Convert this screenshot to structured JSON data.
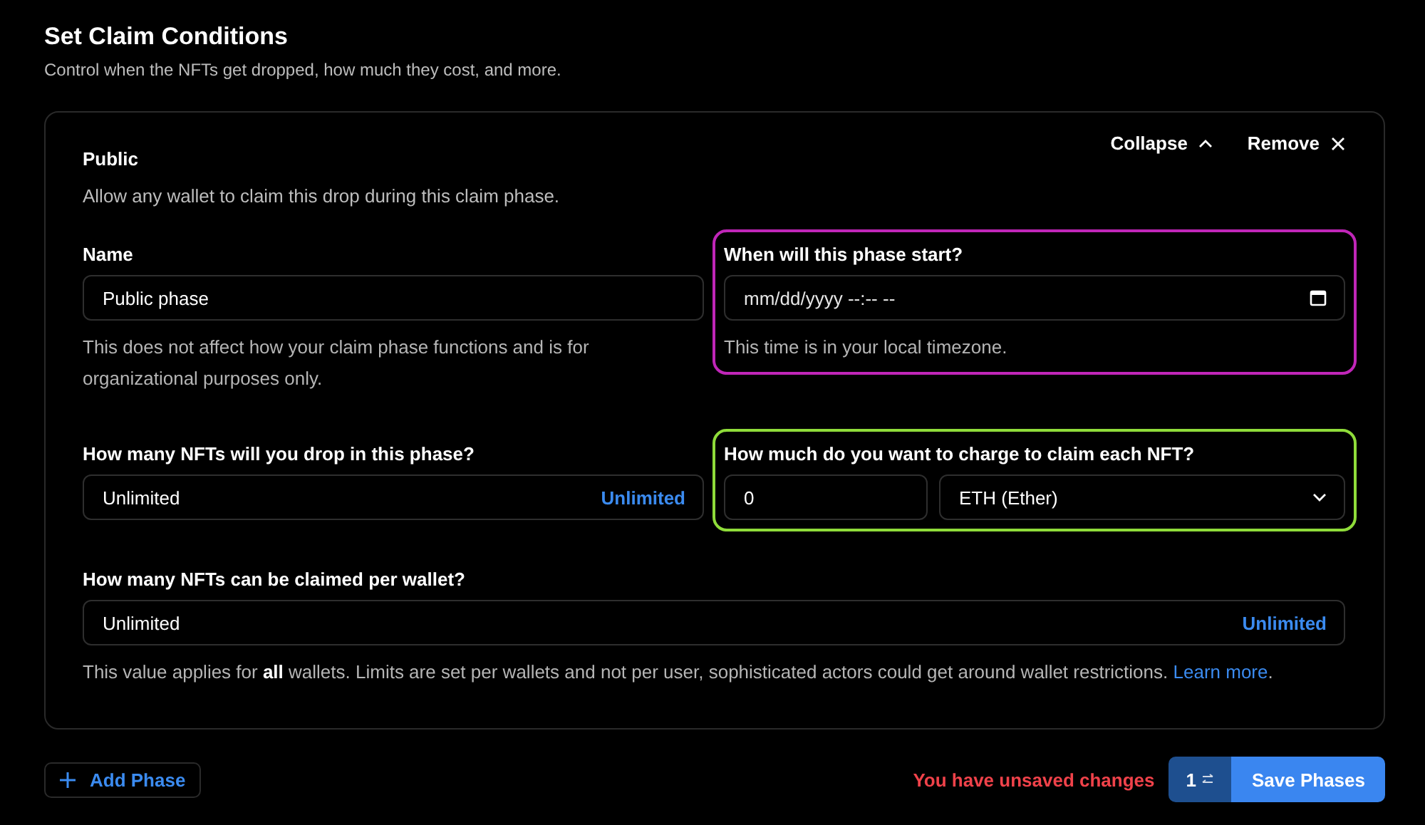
{
  "header": {
    "title": "Set Claim Conditions",
    "subtitle": "Control when the NFTs get dropped, how much they cost, and more."
  },
  "phase": {
    "title": "Public",
    "description": "Allow any wallet to claim this drop during this claim phase.",
    "actions": [
      {
        "label": "Collapse",
        "kind": "collapse"
      },
      {
        "label": "Remove",
        "kind": "remove"
      }
    ],
    "fields": [
      {
        "kind": "text",
        "label": "Name",
        "value": "Public phase",
        "help": "This does not affect how your claim phase functions and is for organizational purposes only."
      },
      {
        "kind": "date",
        "label": "When will this phase start?",
        "placeholder": "mm/dd/yyyy --:-- --",
        "help": "This time is in your local timezone.",
        "color": "#c026b8"
      },
      {
        "kind": "unlimited",
        "label": "How many NFTs will you drop in this phase?",
        "value": "Unlimited",
        "action": "Unlimited"
      },
      {
        "kind": "price",
        "label": "How much do you want to charge to claim each NFT?",
        "value": "0",
        "currency": "ETH (Ether)",
        "color": "#8fdc3a"
      },
      {
        "kind": "unlimited",
        "wide": true,
        "label": "How many NFTs can be claimed per wallet?",
        "value": "Unlimited",
        "action": "Unlimited",
        "help": "This value applies for **all** wallets. Limits are set per wallets and not per user, sophisticated actors could get around wallet restrictions.",
        "link": "Learn more",
        "after_link": "."
      }
    ]
  },
  "footer": {
    "add_button": "Add Phase",
    "warning": "You have unsaved changes",
    "count": "1",
    "save_button": "Save Phases"
  }
}
